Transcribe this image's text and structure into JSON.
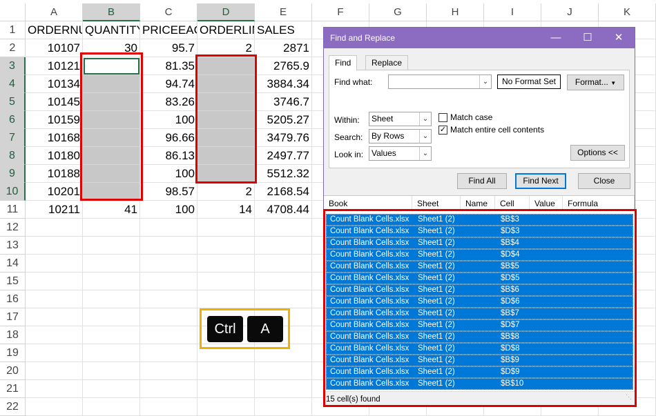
{
  "sheet": {
    "columns": [
      "A",
      "B",
      "C",
      "D",
      "E",
      "F",
      "G",
      "H",
      "I",
      "J",
      "K"
    ],
    "rows": [
      "1",
      "2",
      "3",
      "4",
      "5",
      "6",
      "7",
      "8",
      "9",
      "10",
      "11",
      "12",
      "13",
      "14",
      "15",
      "16",
      "17",
      "18",
      "19",
      "20",
      "21",
      "22"
    ],
    "headers": [
      "ORDERNUMBER",
      "QUANTITY",
      "PRICEEACH",
      "ORDERLINE",
      "SALES"
    ],
    "data": [
      [
        "10107",
        "30",
        "95.7",
        "2",
        "2871"
      ],
      [
        "10121",
        "",
        "81.35",
        "",
        "2765.9"
      ],
      [
        "10134",
        "",
        "94.74",
        "",
        "3884.34"
      ],
      [
        "10145",
        "",
        "83.26",
        "",
        "3746.7"
      ],
      [
        "10159",
        "",
        "100",
        "",
        "5205.27"
      ],
      [
        "10168",
        "",
        "96.66",
        "",
        "3479.76"
      ],
      [
        "10180",
        "",
        "86.13",
        "",
        "2497.77"
      ],
      [
        "10188",
        "",
        "100",
        "",
        "5512.32"
      ],
      [
        "10201",
        "",
        "98.57",
        "2",
        "2168.54"
      ],
      [
        "10211",
        "41",
        "100",
        "14",
        "4708.44"
      ]
    ]
  },
  "keyboard_hint": {
    "keys": [
      "Ctrl",
      "A"
    ]
  },
  "dialog": {
    "title": "Find and Replace",
    "tabs": [
      "Find",
      "Replace"
    ],
    "find_what_label": "Find what:",
    "find_what_value": "",
    "no_format_label": "No Format Set",
    "format_label": "Format...",
    "within_label": "Within:",
    "within_value": "Sheet",
    "search_label": "Search:",
    "search_value": "By Rows",
    "lookin_label": "Look in:",
    "lookin_value": "Values",
    "match_case_label": "Match case",
    "match_case_checked": false,
    "match_entire_label": "Match entire cell contents",
    "match_entire_checked": true,
    "options_label": "Options <<",
    "find_all_label": "Find All",
    "find_next_label": "Find Next",
    "close_label": "Close",
    "result_columns": [
      "Book",
      "Sheet",
      "Name",
      "Cell",
      "Value",
      "Formula"
    ],
    "results": [
      {
        "book": "Count Blank Cells.xlsx",
        "sheet": "Sheet1 (2)",
        "cell": "$B$3"
      },
      {
        "book": "Count Blank Cells.xlsx",
        "sheet": "Sheet1 (2)",
        "cell": "$D$3"
      },
      {
        "book": "Count Blank Cells.xlsx",
        "sheet": "Sheet1 (2)",
        "cell": "$B$4"
      },
      {
        "book": "Count Blank Cells.xlsx",
        "sheet": "Sheet1 (2)",
        "cell": "$D$4"
      },
      {
        "book": "Count Blank Cells.xlsx",
        "sheet": "Sheet1 (2)",
        "cell": "$B$5"
      },
      {
        "book": "Count Blank Cells.xlsx",
        "sheet": "Sheet1 (2)",
        "cell": "$D$5"
      },
      {
        "book": "Count Blank Cells.xlsx",
        "sheet": "Sheet1 (2)",
        "cell": "$B$6"
      },
      {
        "book": "Count Blank Cells.xlsx",
        "sheet": "Sheet1 (2)",
        "cell": "$D$6"
      },
      {
        "book": "Count Blank Cells.xlsx",
        "sheet": "Sheet1 (2)",
        "cell": "$B$7"
      },
      {
        "book": "Count Blank Cells.xlsx",
        "sheet": "Sheet1 (2)",
        "cell": "$D$7"
      },
      {
        "book": "Count Blank Cells.xlsx",
        "sheet": "Sheet1 (2)",
        "cell": "$B$8"
      },
      {
        "book": "Count Blank Cells.xlsx",
        "sheet": "Sheet1 (2)",
        "cell": "$D$8"
      },
      {
        "book": "Count Blank Cells.xlsx",
        "sheet": "Sheet1 (2)",
        "cell": "$B$9"
      },
      {
        "book": "Count Blank Cells.xlsx",
        "sheet": "Sheet1 (2)",
        "cell": "$D$9"
      },
      {
        "book": "Count Blank Cells.xlsx",
        "sheet": "Sheet1 (2)",
        "cell": "$B$10"
      }
    ],
    "status_text": "15 cell(s) found"
  },
  "colors": {
    "accent": "#217346",
    "titlebar": "#8b6cc1",
    "selection": "#0078d7",
    "highlight_red": "#e00000",
    "highlight_yellow": "#f0b000",
    "blank_fill": "#c8c8c8"
  }
}
